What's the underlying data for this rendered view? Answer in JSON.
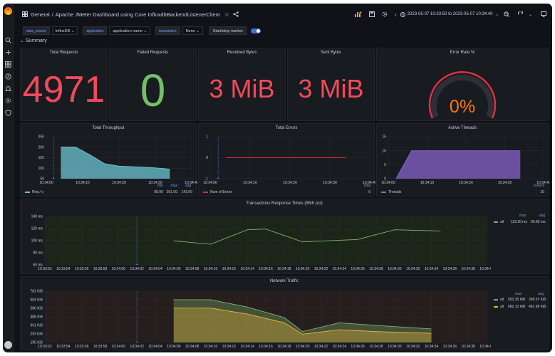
{
  "topbar": {
    "section": "General",
    "title": "Apache JMeter Dashboard using Core InfluxdbBackendListenerClient",
    "time_range": "2023-05-07 10:33:50 to 2023-05-07 10:34:40"
  },
  "variables": [
    {
      "label": "data_source",
      "value": "InfluxDB"
    },
    {
      "label": "application",
      "value": "application name"
    },
    {
      "label": "transaction",
      "value": "None"
    }
  ],
  "marker_button": "Start/stop marker",
  "summary_row": "Summary",
  "stats": {
    "total_requests": {
      "title": "Total Requests",
      "value": "4971",
      "color": "#f2495c"
    },
    "failed_requests": {
      "title": "Failed Requests",
      "value": "0",
      "color": "#73bf69"
    },
    "received_bytes": {
      "title": "Received Bytes",
      "value": "3 MiB",
      "color": "#f2495c"
    },
    "sent_bytes": {
      "title": "Sent Bytes",
      "value": "3 MiB",
      "color": "#f2495c"
    },
    "error_rate": {
      "title": "Error Rate %",
      "value": "0%",
      "color": "#ff780a",
      "gauge_fraction": 0
    }
  },
  "chart_data": [
    {
      "type": "area",
      "title": "Total Throughput",
      "x": [
        "10:34:00",
        "10:34:10",
        "10:34:20",
        "10:34:30",
        "10:34:40"
      ],
      "y_ticks": [
        "50",
        "100",
        "150",
        "200",
        "250"
      ],
      "ylim": [
        50,
        250
      ],
      "series": [
        {
          "name": "Req / s",
          "color": "#6cc5d4",
          "points": [
            [
              "10:34:04",
              201
            ],
            [
              "10:34:08",
              201
            ],
            [
              "10:34:12",
              164
            ],
            [
              "10:34:16",
              122
            ],
            [
              "10:34:20",
              110
            ],
            [
              "10:34:24",
              107
            ],
            [
              "10:34:28",
              104
            ],
            [
              "10:34:32",
              99
            ],
            [
              "10:34:34",
              95
            ]
          ]
        }
      ],
      "legend": {
        "columns": [
          "min",
          "max",
          "avg"
        ],
        "values": [
          "95.00",
          "201.00",
          "142.00"
        ]
      }
    },
    {
      "type": "line",
      "title": "Total Errors",
      "x": [
        "10:34:00",
        "10:34:10",
        "10:34:20",
        "10:34:30",
        "10:34:40"
      ],
      "y_ticks": [
        "-1",
        "0",
        "1"
      ],
      "ylim": [
        -1,
        1
      ],
      "series": [
        {
          "name": "Num of Errors",
          "color": "#e02f44",
          "points": [
            [
              "10:34:04",
              0
            ],
            [
              "10:34:34",
              0
            ]
          ]
        }
      ],
      "legend": {
        "columns": [
          "total"
        ],
        "values": [
          "0"
        ]
      }
    },
    {
      "type": "area",
      "title": "Active Threads",
      "x": [
        "10:34:00",
        "10:34:10",
        "10:34:20",
        "10:34:30",
        "10:34:40"
      ],
      "y_ticks": [
        "0",
        "5",
        "10",
        "15"
      ],
      "ylim": [
        0,
        15
      ],
      "series": [
        {
          "name": "Threads",
          "color": "#8f67d7",
          "points": [
            [
              "10:34:02",
              0
            ],
            [
              "10:34:06",
              10
            ],
            [
              "10:34:34",
              10
            ]
          ]
        }
      ],
      "legend": {
        "columns": [
          "current"
        ],
        "values": [
          "10"
        ]
      }
    },
    {
      "type": "line",
      "title": "Transactions Response Times (95th pct)",
      "x": [
        "10:33:52",
        "10:33:54",
        "10:33:56",
        "10:33:58",
        "10:34:00",
        "10:34:02",
        "10:34:04",
        "10:34:06",
        "10:34:08",
        "10:34:10",
        "10:34:12",
        "10:34:14",
        "10:34:16",
        "10:34:18",
        "10:34:20",
        "10:34:22",
        "10:34:24",
        "10:34:26",
        "10:34:28",
        "10:34:30",
        "10:34:32",
        "10:34:34",
        "10:34:36",
        "10:34:38",
        "10:34:40"
      ],
      "y_ticks": [
        "60 ms",
        "80 ms",
        "100 ms",
        "120 ms",
        "140 ms"
      ],
      "ylim": [
        60,
        140
      ],
      "series": [
        {
          "name": "all",
          "color": "#7eb26d",
          "points": [
            [
              "10:34:06",
              99.8
            ],
            [
              "10:34:10",
              94
            ],
            [
              "10:34:14",
              118
            ],
            [
              "10:34:16",
              119.2
            ],
            [
              "10:34:20",
              98
            ],
            [
              "10:34:26",
              102
            ],
            [
              "10:34:30",
              118
            ],
            [
              "10:34:35",
              116
            ]
          ]
        }
      ],
      "legend": {
        "columns": [
          "max",
          "avg"
        ],
        "rows": [
          [
            "119.20 ms",
            "99.80 ms"
          ]
        ]
      }
    },
    {
      "type": "area",
      "title": "Network Traffic",
      "x": [
        "10:33:52",
        "10:33:54",
        "10:33:56",
        "10:33:58",
        "10:34:00",
        "10:34:02",
        "10:34:04",
        "10:34:06",
        "10:34:08",
        "10:34:10",
        "10:34:12",
        "10:34:14",
        "10:34:16",
        "10:34:18",
        "10:34:20",
        "10:34:22",
        "10:34:24",
        "10:34:26",
        "10:34:28",
        "10:34:30",
        "10:34:32",
        "10:34:34",
        "10:34:36",
        "10:34:38",
        "10:34:40"
      ],
      "y_ticks": [
        "195 KiB",
        "293 KiB",
        "391 KiB",
        "488 KiB",
        "586 KiB",
        "684 KiB",
        "781 KiB"
      ],
      "ylim": [
        195,
        781
      ],
      "series": [
        {
          "name": "all",
          "color": "#7eb26d",
          "points": [
            [
              "10:34:06",
              684
            ],
            [
              "10:34:10",
              684
            ],
            [
              "10:34:14",
              600
            ],
            [
              "10:34:18",
              480
            ],
            [
              "10:34:20",
              320
            ],
            [
              "10:34:24",
              420
            ],
            [
              "10:34:28",
              390
            ],
            [
              "10:34:34",
              350
            ]
          ]
        },
        {
          "name": "all",
          "color": "#eab839",
          "points": [
            [
              "10:34:06",
              588
            ],
            [
              "10:34:10",
              588
            ],
            [
              "10:34:14",
              520
            ],
            [
              "10:34:18",
              420
            ],
            [
              "10:34:20",
              290
            ],
            [
              "10:34:24",
              340
            ],
            [
              "10:34:28",
              320
            ],
            [
              "10:34:34",
              300
            ]
          ]
        }
      ],
      "legend": {
        "columns": [
          "max",
          "avg"
        ],
        "rows": [
          [
            "563.35 KiB",
            "398.07 KiB"
          ],
          [
            "682.10 KiB",
            "481.98 KiB"
          ]
        ]
      }
    }
  ]
}
